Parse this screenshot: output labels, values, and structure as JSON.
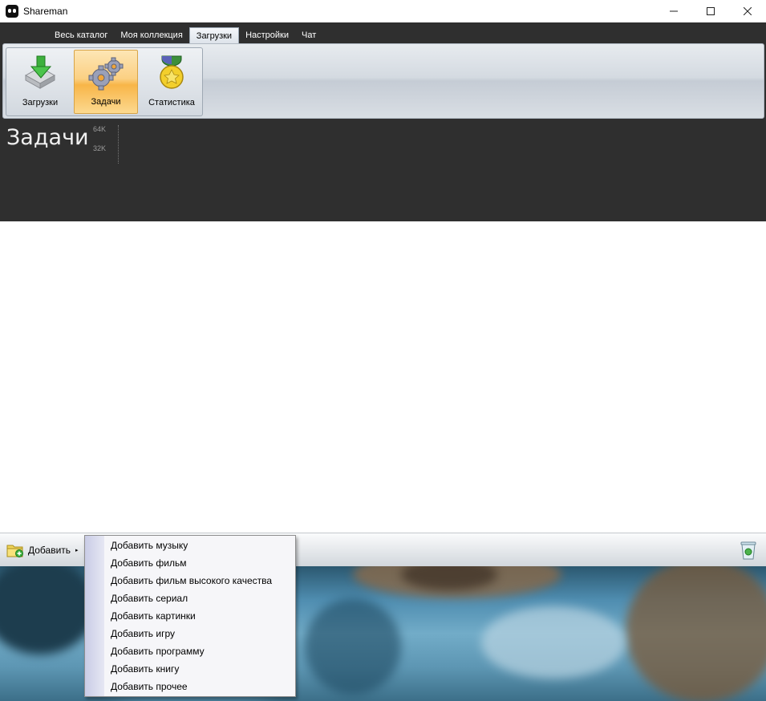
{
  "window": {
    "title": "Shareman",
    "controls": [
      "minimize",
      "maximize",
      "close"
    ]
  },
  "menu": {
    "items": [
      {
        "label": "Весь каталог"
      },
      {
        "label": "Моя коллекция"
      },
      {
        "label": "Загрузки",
        "active": true
      },
      {
        "label": "Настройки"
      },
      {
        "label": "Чат"
      }
    ]
  },
  "ribbon": {
    "buttons": [
      {
        "label": "Загрузки",
        "icon": "download-icon"
      },
      {
        "label": "Задачи",
        "icon": "gears-icon",
        "active": true
      },
      {
        "label": "Статистика",
        "icon": "medal-icon"
      }
    ]
  },
  "content": {
    "title": "Задачи",
    "scale_top": "64K",
    "scale_bottom": "32K"
  },
  "toolbar": {
    "add_label": "Добавить",
    "add_arrow": "▸"
  },
  "dropdown": {
    "items": [
      "Добавить музыку",
      "Добавить фильм",
      "Добавить фильм высокого качества",
      "Добавить сериал",
      "Добавить картинки",
      "Добавить игру",
      "Добавить программу",
      "Добавить книгу",
      "Добавить прочее"
    ]
  },
  "colors": {
    "dark_background": "#2f2f2f",
    "active_button": "#f8b548",
    "menu_gutter": "#c9cce6"
  }
}
